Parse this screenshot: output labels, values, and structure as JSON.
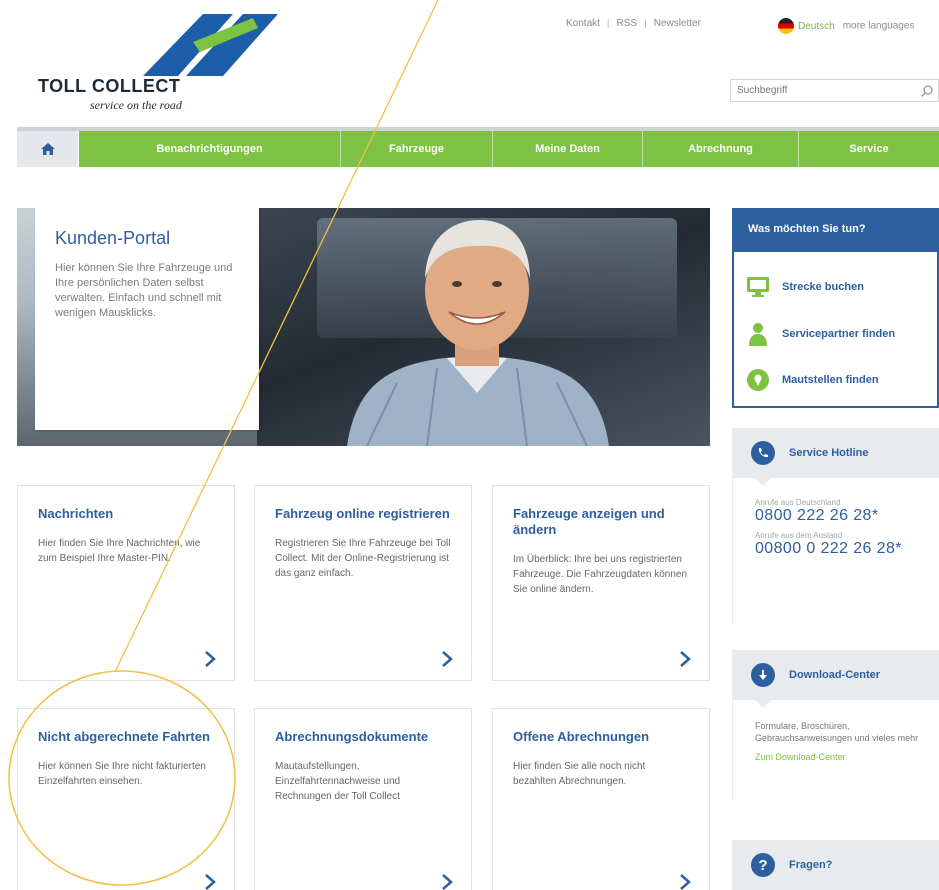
{
  "header": {
    "logo": {
      "name": "TOLL COLLECT",
      "tagline": "service on the road"
    },
    "toplinks": [
      "Kontakt",
      "RSS",
      "Newsletter"
    ],
    "language": {
      "current": "Deutsch",
      "more": "more languages"
    },
    "search": {
      "placeholder": "Suchbegriff"
    }
  },
  "nav": {
    "home_icon": "home-icon",
    "items": [
      "Benachrichtigungen",
      "Fahrzeuge",
      "Meine Daten",
      "Abrechnung",
      "Service"
    ]
  },
  "hero": {
    "title": "Kunden-Portal",
    "text": "Hier können Sie Ihre Fahrzeuge und Ihre persönlichen Daten selbst verwalten. Einfach und schnell mit wenigen Mausklicks."
  },
  "cards": [
    {
      "title": "Nachrichten",
      "text": "Hier finden Sie Ihre Nachrichten, wie zum Beispiel Ihre Master-PIN."
    },
    {
      "title": "Fahrzeug online registrieren",
      "text": "Registrieren Sie Ihre Fahrzeuge bei Toll Collect. Mit der Online-Registrierung ist das ganz einfach."
    },
    {
      "title": "Fahrzeuge anzeigen und ändern",
      "text": "Im Überblick: Ihre bei uns registrierten Fahrzeuge. Die Fahrzeugdaten können Sie online ändern."
    },
    {
      "title": "Nicht abgerechnete Fahrten",
      "text": "Hier können Sie Ihre nicht fakturierten Einzelfahrten einsehen."
    },
    {
      "title": "Abrechnungsdokumente",
      "text": "Mautaufstellungen, Einzelfahrtennachweise und Rechnungen der Toll Collect"
    },
    {
      "title": "Offene Abrechnungen",
      "text": "Hier finden Sie alle noch nicht bezahlten Abrechnungen."
    }
  ],
  "sidebar": {
    "todo": {
      "title": "Was möchten Sie tun?",
      "items": [
        "Strecke buchen",
        "Servicepartner finden",
        "Mautstellen finden"
      ]
    },
    "hotline": {
      "title": "Service Hotline",
      "de_label": "Anrufe aus Deutschland",
      "de_number": "0800 222 26 28*",
      "abroad_label": "Anrufe aus dem Ausland",
      "abroad_number": "00800 0 222 26 28*"
    },
    "download": {
      "title": "Download-Center",
      "text": "Formulare, Broschüren, Gebrauchsanweisungen und vieles mehr",
      "link": "Zum Download-Center"
    },
    "faq": {
      "title": "Fragen?"
    }
  },
  "colors": {
    "brand_blue": "#2d5f9f",
    "brand_green": "#7dc242",
    "annotation": "#f0c040"
  }
}
